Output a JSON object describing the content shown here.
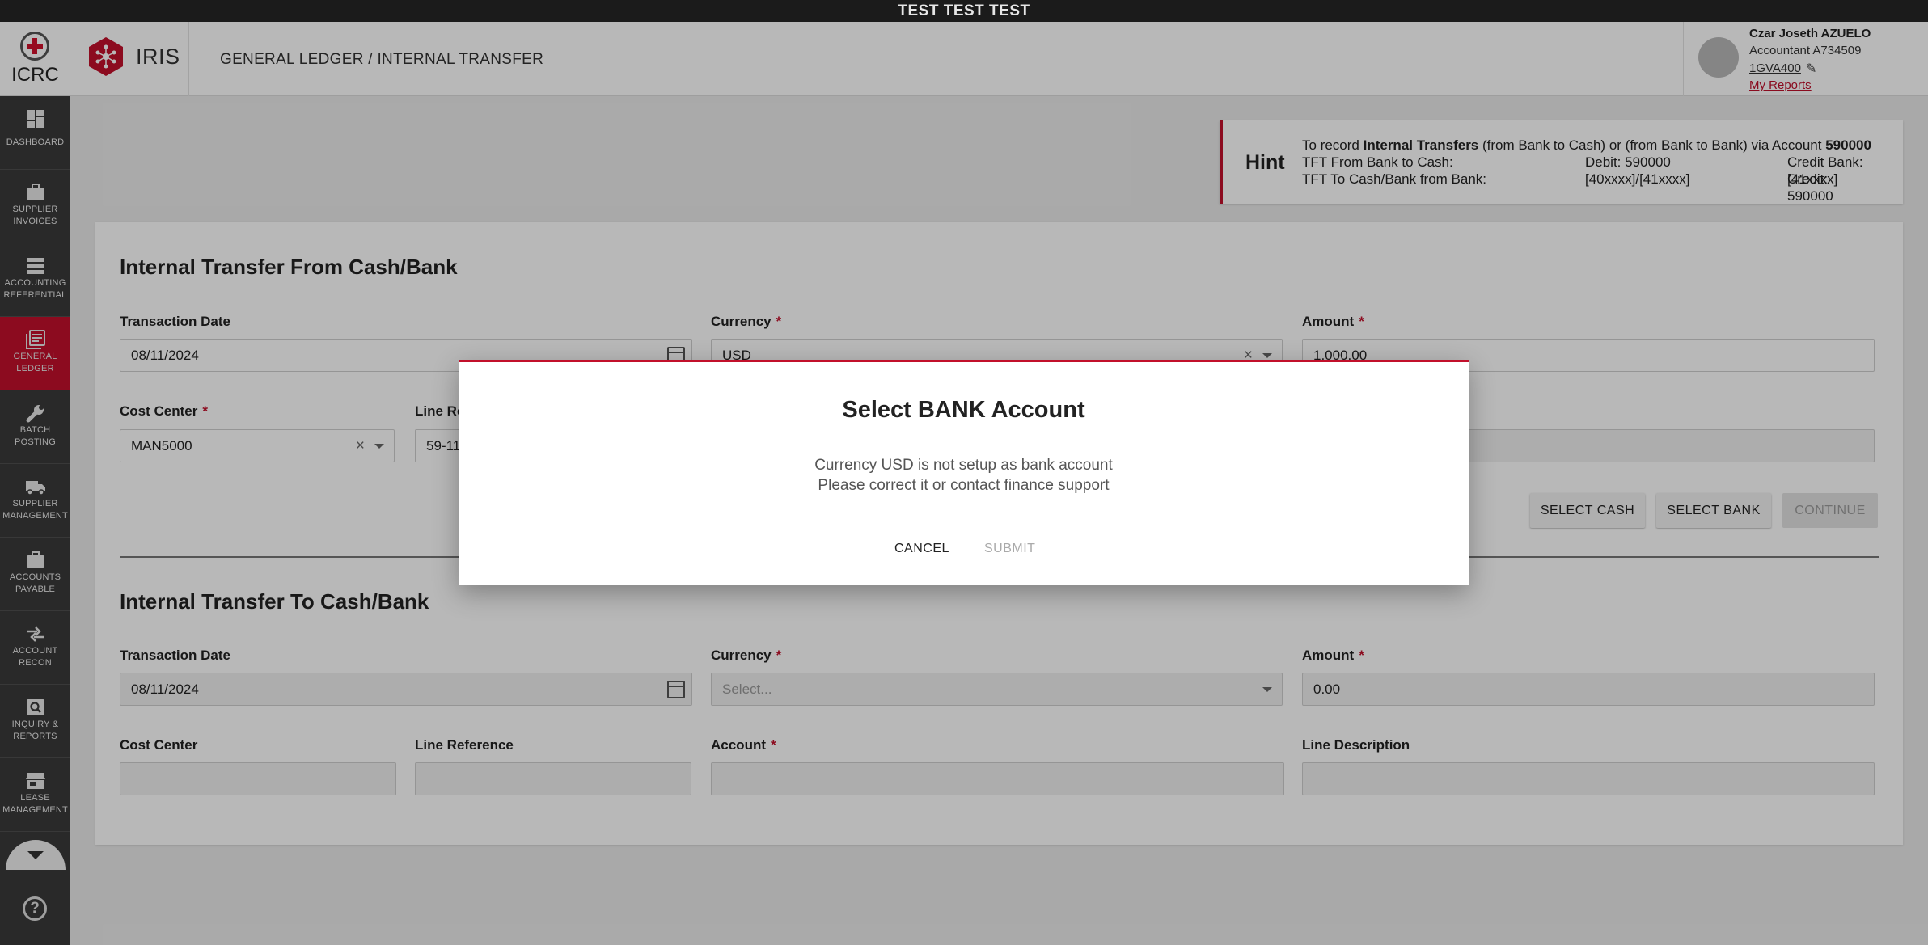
{
  "env_banner": "TEST TEST TEST",
  "header": {
    "org": "ICRC",
    "app": "IRIS",
    "breadcrumb": "GENERAL LEDGER / INTERNAL TRANSFER",
    "user": {
      "name": "Czar Joseth AZUELO",
      "role": "Accountant A734509",
      "code": "1GVA400",
      "reports_link": "My Reports"
    }
  },
  "sidebar": {
    "items": [
      {
        "label1": "DASHBOARD",
        "label2": "",
        "icon": "dashboard-icon"
      },
      {
        "label1": "SUPPLIER",
        "label2": "INVOICES",
        "icon": "briefcase-icon"
      },
      {
        "label1": "ACCOUNTING",
        "label2": "REFERENTIAL",
        "icon": "storage-icon"
      },
      {
        "label1": "GENERAL",
        "label2": "LEDGER",
        "icon": "ledger-icon",
        "active": true
      },
      {
        "label1": "BATCH",
        "label2": "POSTING",
        "icon": "wrench-icon"
      },
      {
        "label1": "SUPPLIER",
        "label2": "MANAGEMENT",
        "icon": "truck-icon"
      },
      {
        "label1": "ACCOUNTS",
        "label2": "PAYABLE",
        "icon": "briefcase-icon"
      },
      {
        "label1": "ACCOUNT",
        "label2": "RECON",
        "icon": "compare-arrows-icon"
      },
      {
        "label1": "INQUIRY &",
        "label2": "REPORTS",
        "icon": "search-report-icon"
      },
      {
        "label1": "LEASE",
        "label2": "MANAGEMENT",
        "icon": "store-icon"
      }
    ],
    "help": "?"
  },
  "hint": {
    "title": "Hint",
    "line1_pre": "To record ",
    "line1_bold": "Internal Transfers",
    "line1_post": " (from Bank to Cash) or (from Bank to Bank) via Account ",
    "line1_account": "590000",
    "rows": [
      {
        "col1": "TFT From Bank to Cash:",
        "col2": "Debit: 590000",
        "col3": "Credit Bank: [41xxxx]"
      },
      {
        "col1": "TFT To Cash/Bank from Bank:",
        "col2": "[40xxxx]/[41xxxx]",
        "col3": "Credit: 590000"
      }
    ]
  },
  "from_section": {
    "title": "Internal Transfer From Cash/Bank",
    "transaction_date_label": "Transaction Date",
    "transaction_date": "08/11/2024",
    "currency_label": "Currency",
    "currency": "USD",
    "amount_label": "Amount",
    "amount": "1,000.00",
    "cost_center_label": "Cost Center",
    "cost_center": "MAN5000",
    "line_ref_label": "Line Re",
    "line_ref": "59-11",
    "buttons": {
      "select_cash": "SELECT CASH",
      "select_bank": "SELECT BANK",
      "continue": "CONTINUE"
    }
  },
  "to_section": {
    "title": "Internal Transfer To Cash/Bank",
    "transaction_date_label": "Transaction Date",
    "transaction_date": "08/11/2024",
    "currency_label": "Currency",
    "currency_placeholder": "Select...",
    "amount_label": "Amount",
    "amount": "0.00",
    "cost_center_label": "Cost Center",
    "line_ref_label": "Line Reference",
    "account_label": "Account",
    "line_desc_label": "Line Description"
  },
  "dialog": {
    "title": "Select BANK Account",
    "message_line1": "Currency USD is not setup as bank account",
    "message_line2": "Please correct it or contact finance support",
    "cancel": "CANCEL",
    "submit": "SUBMIT"
  },
  "colors": {
    "accent": "#c2102b",
    "sidebar_bg": "#3a3a3a",
    "env_bar_bg": "#1b1b1b"
  }
}
